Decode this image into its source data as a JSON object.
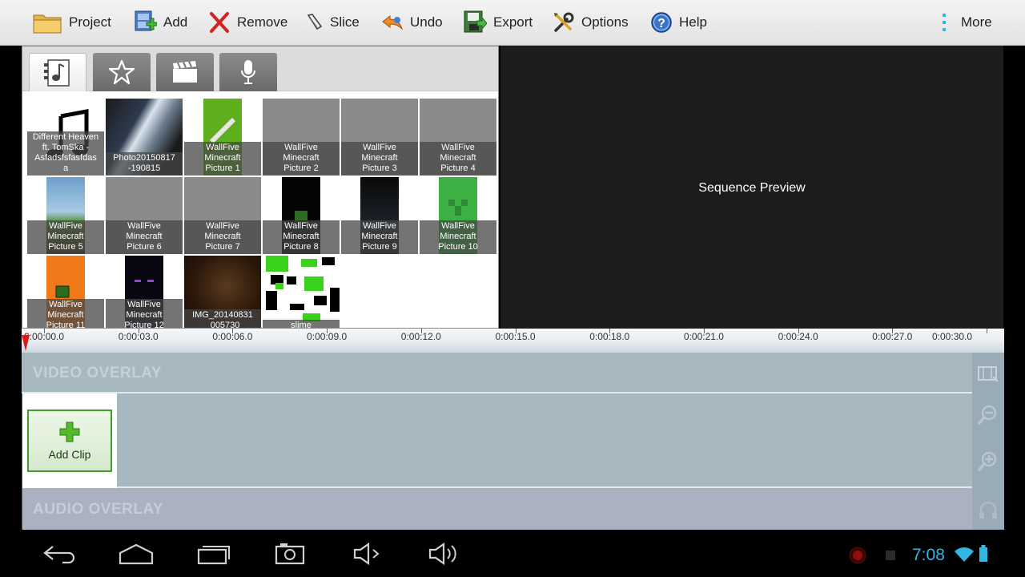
{
  "toolbar": {
    "items": [
      {
        "label": "Project",
        "icon": "folder-icon"
      },
      {
        "label": "Add",
        "icon": "add-media-icon"
      },
      {
        "label": "Remove",
        "icon": "remove-x-icon"
      },
      {
        "label": "Slice",
        "icon": "slice-icon"
      },
      {
        "label": "Undo",
        "icon": "undo-arrow-icon"
      },
      {
        "label": "Export",
        "icon": "export-icon"
      },
      {
        "label": "Options",
        "icon": "tools-icon"
      },
      {
        "label": "Help",
        "icon": "help-icon"
      }
    ],
    "more_label": "More"
  },
  "library": {
    "tabs": [
      {
        "icon": "media-files-icon",
        "active": true
      },
      {
        "icon": "star-icon",
        "active": false
      },
      {
        "icon": "clapperboard-icon",
        "active": false
      },
      {
        "icon": "microphone-icon",
        "active": false
      }
    ],
    "items": [
      {
        "caption": "Different Heaven\nft. TomSka -\nAsfadsfsfasfdas\na",
        "bg": "#ffffff",
        "art": "music"
      },
      {
        "caption": "Photo20150817\n-190815",
        "bg": "#1a1a1a",
        "art": "photo"
      },
      {
        "caption": "WallFive\nMinecraft\nPicture 1",
        "bg": "#5fae1c",
        "art": "sword"
      },
      {
        "caption": "WallFive\nMinecraft\nPicture 2",
        "bg": "#8a8a8a",
        "art": "gray"
      },
      {
        "caption": "WallFive\nMinecraft\nPicture 3",
        "bg": "#8a8a8a",
        "art": "gray"
      },
      {
        "caption": "WallFive\nMinecraft\nPicture 4",
        "bg": "#8a8a8a",
        "art": "gray"
      },
      {
        "caption": "WallFive\nMinecraft\nPicture 5",
        "bg": "#6da0cc",
        "art": "landscape"
      },
      {
        "caption": "WallFive\nMinecraft\nPicture 6",
        "bg": "#8a8a8a",
        "art": "gray"
      },
      {
        "caption": "WallFive\nMinecraft\nPicture 7",
        "bg": "#8a8a8a",
        "art": "gray"
      },
      {
        "caption": "WallFive\nMinecraft\nPicture 8",
        "bg": "#050505",
        "art": "dark"
      },
      {
        "caption": "WallFive\nMinecraft\nPicture 9",
        "bg": "#0a0a0a",
        "art": "dark"
      },
      {
        "caption": "WallFive\nMinecraft\nPicture 10",
        "bg": "#3cb043",
        "art": "creeper"
      },
      {
        "caption": "WallFive\nMinecraft\nPicture 11",
        "bg": "#f07a1a",
        "art": "orange"
      },
      {
        "caption": "WallFive\nMinecraft\nPicture 12",
        "bg": "#080812",
        "art": "dark"
      },
      {
        "caption": "IMG_20140831\n_005730",
        "bg": "#3a2412",
        "art": "brown"
      },
      {
        "caption": "slime",
        "bg": "#ffffff",
        "art": "slime"
      }
    ]
  },
  "preview": {
    "label": "Sequence Preview"
  },
  "timeline": {
    "ticks": [
      "0:00:00.0",
      "0:00:03.0",
      "0:00:06.0",
      "0:00:09.0",
      "0:00:12.0",
      "0:00:15.0",
      "0:00:18.0",
      "0:00:21.0",
      "0:00:24.0",
      "0:00:27.0",
      "0:00:30.0"
    ],
    "video_overlay_label": "VIDEO OVERLAY",
    "audio_overlay_label": "AUDIO OVERLAY",
    "add_clip_label": "Add Clip"
  },
  "statusbar": {
    "time": "7:08"
  },
  "colors": {
    "accent_clock": "#33b5e5",
    "playhead": "#d81b1b",
    "add_clip_border": "#3f9f2a"
  }
}
